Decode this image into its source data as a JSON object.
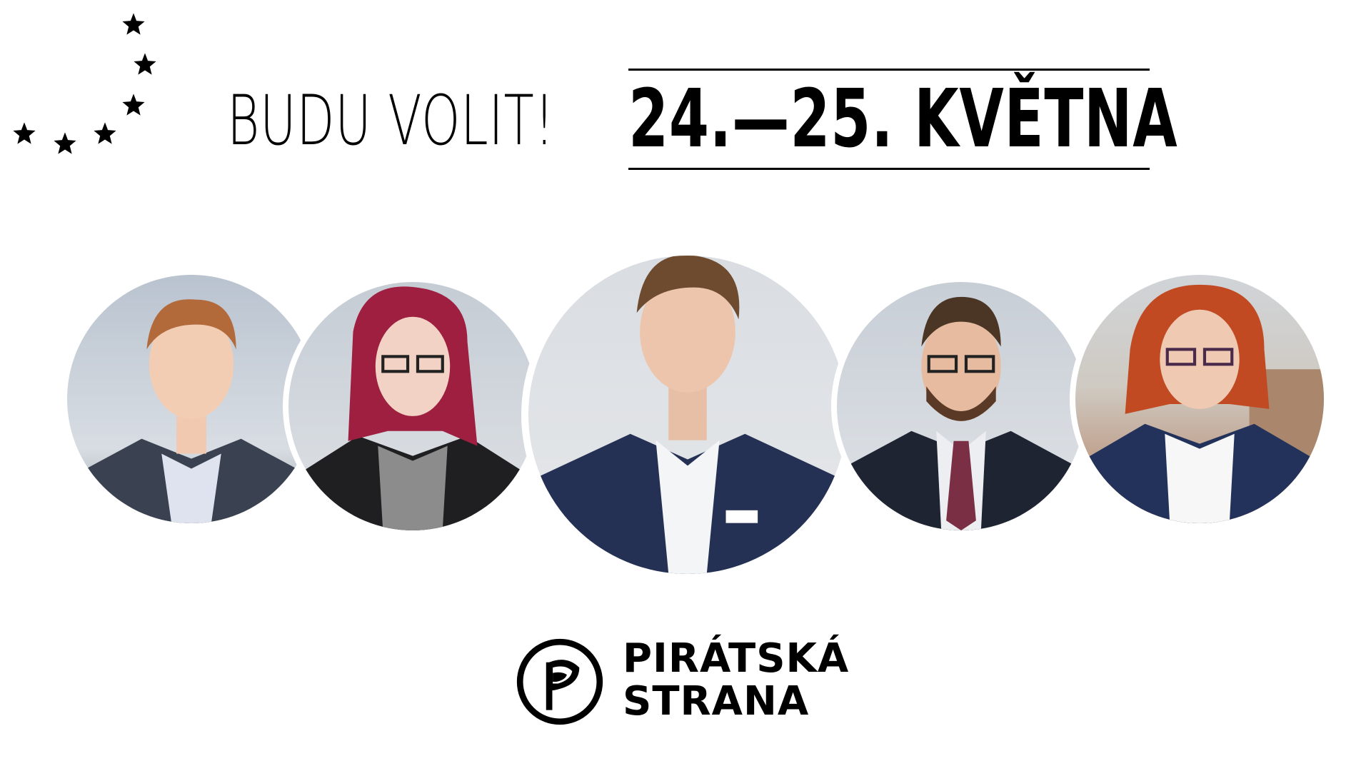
{
  "headline": {
    "left_text": "BUDU VOLIT!",
    "date_text": "24.—25. KVĚTNA"
  },
  "stars": {
    "count": 6,
    "icon": "star-icon",
    "color": "#000000"
  },
  "portraits": {
    "count": 5,
    "background_color": "#d9dde3"
  },
  "logo": {
    "icon": "pirate-flag-icon",
    "line1": "PIRÁTSKÁ",
    "line2": "STRANA"
  },
  "colors": {
    "background": "#ffffff",
    "text": "#000000"
  }
}
